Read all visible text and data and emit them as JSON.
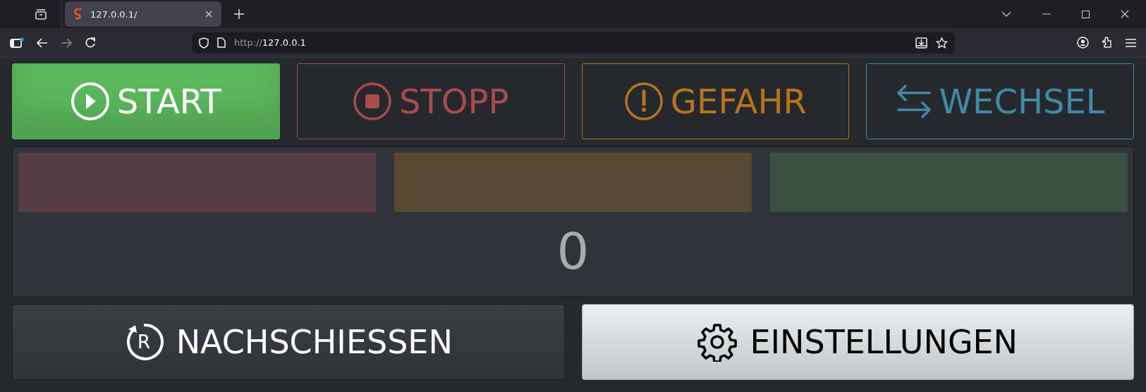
{
  "browser": {
    "tabs": [
      {
        "title": "127.0.0.1/",
        "selected": true
      }
    ],
    "url_scheme": "http://",
    "url_host": "127.0.0.1"
  },
  "top_buttons": [
    {
      "label": "START",
      "kind": "play",
      "color": "#5cb85c"
    },
    {
      "label": "STOPP",
      "kind": "stop",
      "color": "#a94b4b"
    },
    {
      "label": "GEFAHR",
      "kind": "warning",
      "color": "#b8731b"
    },
    {
      "label": "WECHSEL",
      "kind": "swap",
      "color": "#3f8ba3"
    }
  ],
  "lights": [
    {
      "color": "#573d43"
    },
    {
      "color": "#574932"
    },
    {
      "color": "#3a5142"
    }
  ],
  "counter": "0",
  "bottom_buttons": [
    {
      "label": "NACHSCHIESSEN",
      "kind": "reshoot",
      "icon_letter": "R"
    },
    {
      "label": "EINSTELLUNGEN",
      "kind": "settings"
    }
  ]
}
